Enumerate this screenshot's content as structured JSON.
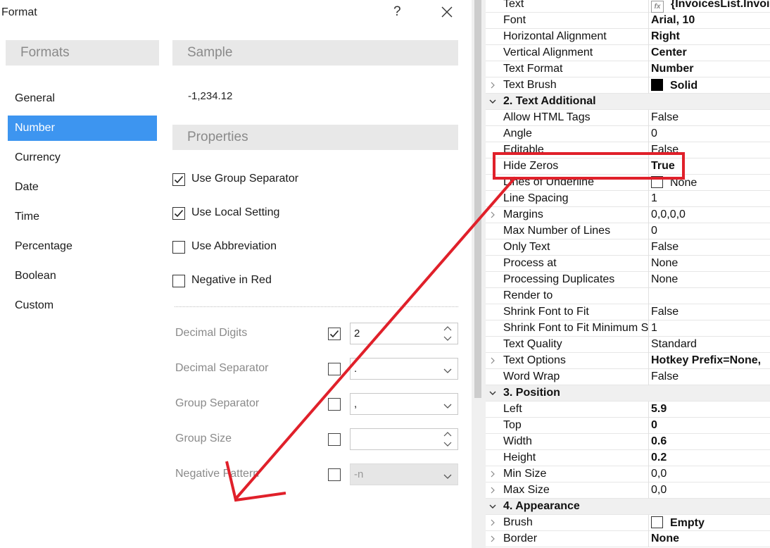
{
  "dialog": {
    "title": "Format",
    "help_glyph": "?",
    "formats_header": "Formats",
    "format_items": [
      "General",
      "Number",
      "Currency",
      "Date",
      "Time",
      "Percentage",
      "Boolean",
      "Custom"
    ],
    "selected_format": "Number",
    "sample_header": "Sample",
    "sample_value": "-1,234.12",
    "properties_header": "Properties",
    "checkboxes": [
      {
        "label": "Use Group Separator",
        "checked": true
      },
      {
        "label": "Use Local Setting",
        "checked": true
      },
      {
        "label": "Use Abbreviation",
        "checked": false
      },
      {
        "label": "Negative in Red",
        "checked": false
      }
    ],
    "fields": [
      {
        "label": "Decimal Digits",
        "checked": true,
        "value": "2",
        "control": "spinner",
        "disabled": false
      },
      {
        "label": "Decimal Separator",
        "checked": false,
        "value": ".",
        "control": "dropdown",
        "disabled": false
      },
      {
        "label": "Group Separator",
        "checked": false,
        "value": ",",
        "control": "dropdown",
        "disabled": false
      },
      {
        "label": "Group Size",
        "checked": false,
        "value": "",
        "control": "spinner",
        "disabled": false
      },
      {
        "label": "Negative Pattern",
        "checked": false,
        "value": "-n",
        "control": "dropdown",
        "disabled": true
      }
    ]
  },
  "property_grid": {
    "rows": [
      {
        "name": "Text",
        "value": "{InvoicesList.Invoi",
        "bold": true,
        "icon": "fx-icon"
      },
      {
        "name": "Font",
        "value": "Arial, 10",
        "bold": true
      },
      {
        "name": "Horizontal Alignment",
        "value": "Right",
        "bold": true
      },
      {
        "name": "Vertical Alignment",
        "value": "Center",
        "bold": true
      },
      {
        "name": "Text Format",
        "value": "Number",
        "bold": true
      },
      {
        "name": "Text Brush",
        "value": "Solid",
        "bold": true,
        "expand": true,
        "swatch": "black"
      },
      {
        "name": "2. Text  Additional",
        "category": true
      },
      {
        "name": "Allow HTML Tags",
        "value": "False"
      },
      {
        "name": "Angle",
        "value": "0"
      },
      {
        "name": "Editable",
        "value": "False"
      },
      {
        "name": "Hide Zeros",
        "value": "True",
        "bold": true
      },
      {
        "name": "Lines of Underline",
        "value": "None",
        "swatch": "empty"
      },
      {
        "name": "Line Spacing",
        "value": "1"
      },
      {
        "name": "Margins",
        "value": "0,0,0,0",
        "expand": true
      },
      {
        "name": "Max Number of Lines",
        "value": "0"
      },
      {
        "name": "Only Text",
        "value": "False"
      },
      {
        "name": "Process at",
        "value": "None"
      },
      {
        "name": "Processing Duplicates",
        "value": "None"
      },
      {
        "name": "Render to",
        "value": ""
      },
      {
        "name": "Shrink Font to Fit",
        "value": "False"
      },
      {
        "name": "Shrink Font to Fit Minimum S",
        "value": "1"
      },
      {
        "name": "Text Quality",
        "value": "Standard"
      },
      {
        "name": "Text Options",
        "value": "Hotkey Prefix=None,",
        "bold": true,
        "expand": true
      },
      {
        "name": "Word Wrap",
        "value": "False"
      },
      {
        "name": "3. Position",
        "category": true
      },
      {
        "name": "Left",
        "value": "5.9",
        "bold": true
      },
      {
        "name": "Top",
        "value": "0",
        "bold": true
      },
      {
        "name": "Width",
        "value": "0.6",
        "bold": true
      },
      {
        "name": "Height",
        "value": "0.2",
        "bold": true
      },
      {
        "name": "Min Size",
        "value": "0,0",
        "expand": true
      },
      {
        "name": "Max Size",
        "value": "0,0",
        "expand": true
      },
      {
        "name": "4. Appearance",
        "category": true
      },
      {
        "name": "Brush",
        "value": "Empty",
        "bold": true,
        "expand": true,
        "swatch": "empty"
      },
      {
        "name": "Border",
        "value": "None",
        "bold": true,
        "expand": true
      }
    ]
  },
  "annotation": {
    "highlight_color": "#e0202a",
    "highlighted_row": "Hide Zeros",
    "target": "Negative Pattern"
  },
  "colors": {
    "selection": "#3d95f0",
    "header_bg": "#e8e8e8",
    "category_bg": "#f0f0f0"
  }
}
